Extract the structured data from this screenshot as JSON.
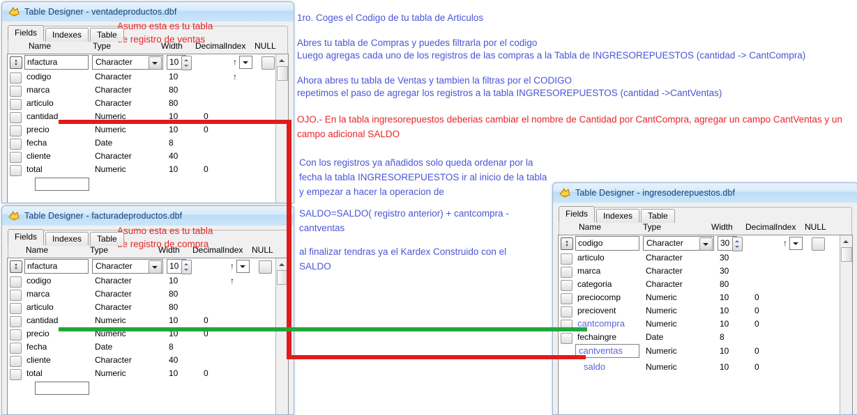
{
  "windows": [
    {
      "title": "Table Designer - ventadeproductos.dbf",
      "icon": "vfp-table-icon",
      "tabs": [
        "Fields",
        "Indexes",
        "Table"
      ],
      "columns": [
        "Name",
        "Type",
        "Width",
        "Decimal",
        "Index",
        "NULL"
      ],
      "active_row": {
        "name": "nfactura",
        "type": "Character",
        "width": "10",
        "decimal": "",
        "index": "↑",
        "null": ""
      },
      "rows": [
        {
          "name": "codigo",
          "type": "Character",
          "width": "10",
          "decimal": "",
          "index": "↑"
        },
        {
          "name": "marca",
          "type": "Character",
          "width": "80",
          "decimal": "",
          "index": ""
        },
        {
          "name": "articulo",
          "type": "Character",
          "width": "80",
          "decimal": "",
          "index": ""
        },
        {
          "name": "cantidad",
          "type": "Numeric",
          "width": "10",
          "decimal": "0",
          "index": ""
        },
        {
          "name": "precio",
          "type": "Numeric",
          "width": "10",
          "decimal": "0",
          "index": ""
        },
        {
          "name": "fecha",
          "type": "Date",
          "width": "8",
          "decimal": "",
          "index": ""
        },
        {
          "name": "cliente",
          "type": "Character",
          "width": "40",
          "decimal": "",
          "index": ""
        },
        {
          "name": "total",
          "type": "Numeric",
          "width": "10",
          "decimal": "0",
          "index": ""
        }
      ],
      "annotation": "Asumo esta es tu tabla\nde registro de ventas"
    },
    {
      "title": "Table Designer - facturadeproductos.dbf",
      "icon": "vfp-table-icon",
      "tabs": [
        "Fields",
        "Indexes",
        "Table"
      ],
      "columns": [
        "Name",
        "Type",
        "Width",
        "Decimal",
        "Index",
        "NULL"
      ],
      "active_row": {
        "name": "nfactura",
        "type": "Character",
        "width": "10",
        "decimal": "",
        "index": "↑",
        "null": ""
      },
      "rows": [
        {
          "name": "codigo",
          "type": "Character",
          "width": "10",
          "decimal": "",
          "index": "↑"
        },
        {
          "name": "marca",
          "type": "Character",
          "width": "80",
          "decimal": "",
          "index": ""
        },
        {
          "name": "articulo",
          "type": "Character",
          "width": "80",
          "decimal": "",
          "index": ""
        },
        {
          "name": "cantidad",
          "type": "Numeric",
          "width": "10",
          "decimal": "0",
          "index": ""
        },
        {
          "name": "precio",
          "type": "Numeric",
          "width": "10",
          "decimal": "0",
          "index": ""
        },
        {
          "name": "fecha",
          "type": "Date",
          "width": "8",
          "decimal": "",
          "index": ""
        },
        {
          "name": "cliente",
          "type": "Character",
          "width": "40",
          "decimal": "",
          "index": ""
        },
        {
          "name": "total",
          "type": "Numeric",
          "width": "10",
          "decimal": "0",
          "index": ""
        }
      ],
      "annotation": "Asumo esta es tu tabla\nde registro de compra"
    },
    {
      "title": "Table Designer - ingresoderepuestos.dbf",
      "icon": "vfp-table-icon",
      "tabs": [
        "Fields",
        "Indexes",
        "Table"
      ],
      "columns": [
        "Name",
        "Type",
        "Width",
        "Decimal",
        "Index",
        "NULL"
      ],
      "active_row": {
        "name": "codigo",
        "type": "Character",
        "width": "30",
        "decimal": "",
        "index": "↑",
        "null": ""
      },
      "rows": [
        {
          "name": "articulo",
          "type": "Character",
          "width": "30",
          "decimal": "",
          "index": ""
        },
        {
          "name": "marca",
          "type": "Character",
          "width": "30",
          "decimal": "",
          "index": ""
        },
        {
          "name": "categoria",
          "type": "Character",
          "width": "80",
          "decimal": "",
          "index": ""
        },
        {
          "name": "preciocomp",
          "type": "Numeric",
          "width": "10",
          "decimal": "0",
          "index": ""
        },
        {
          "name": "preciovent",
          "type": "Numeric",
          "width": "10",
          "decimal": "0",
          "index": ""
        },
        {
          "name": "cantcompra",
          "type": "Numeric",
          "width": "10",
          "decimal": "0",
          "index": ""
        },
        {
          "name": "fechaingre",
          "type": "Date",
          "width": "8",
          "decimal": "",
          "index": ""
        },
        {
          "name": "cantventas",
          "type": "Numeric",
          "width": "10",
          "decimal": "0",
          "index": ""
        },
        {
          "name": "saldo",
          "type": "Numeric",
          "width": "10",
          "decimal": "0",
          "index": ""
        }
      ],
      "annotation": ""
    }
  ],
  "notes": {
    "step1": "1ro. Coges el Codigo de tu tabla de Articulos",
    "step2a": "Abres tu tabla de Compras y puedes filtrarla por el codigo",
    "step2b": "Luego agregas cada uno de los registros de las compras a la Tabla de INGRESOREPUESTOS (cantidad -> CantCompra)",
    "step3a": "Ahora abres tu tabla de Ventas y tambien la filtras por el CODIGO",
    "step3b": "repetimos el paso de agregar los registros a la tabla INGRESOREPUESTOS (cantidad ->CantVentas)",
    "warning": "OJO.- En la tabla ingresorepuestos deberias cambiar el nombre de Cantidad por CantCompra, agregar un campo CantVentas y un\ncampo adicional SALDO",
    "step4": "Con los registros ya añadidos solo queda ordenar por la\nfecha la tabla INGRESOREPUESTOS ir al inicio de la tabla\ny empezar a hacer la operacion de",
    "formula": "SALDO=SALDO( registro anterior) + cantcompra -\ncantventas",
    "step5": "al finalizar tendras ya el Kardex Construido con el\nSALDO"
  },
  "colors": {
    "marker_red": "#e01b1b",
    "marker_green": "#21a83a",
    "note_red": "#e8262a",
    "note_blue": "#4a55d6",
    "highlight_field": "#5b63d6",
    "titlebar_text": "#15427b"
  }
}
